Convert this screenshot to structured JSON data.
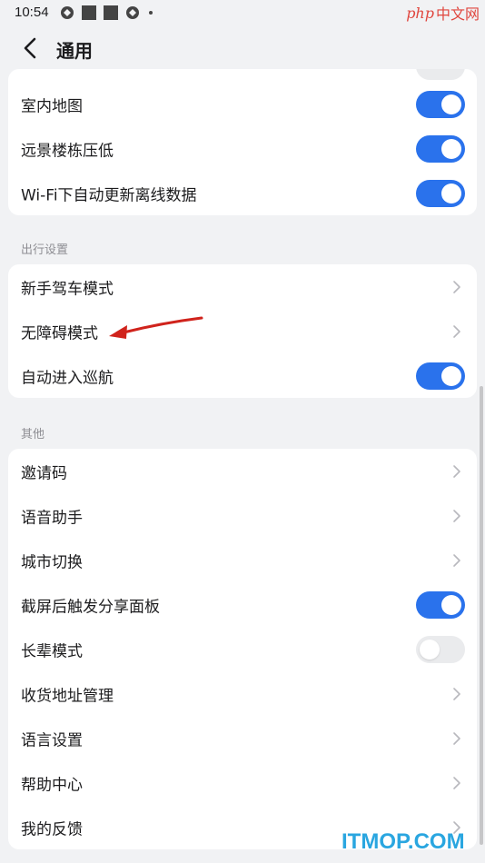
{
  "status_bar": {
    "time": "10:54",
    "logo_php": "php",
    "logo_cn": "中文网"
  },
  "header": {
    "title": "通用"
  },
  "card_top": {
    "items": [
      {
        "label": "室内地图",
        "type": "toggle",
        "on": true
      },
      {
        "label": "远景楼栋压低",
        "type": "toggle",
        "on": true
      },
      {
        "label": "Wi-Fi下自动更新离线数据",
        "type": "toggle",
        "on": true
      }
    ]
  },
  "section_travel": {
    "title": "出行设置",
    "items": [
      {
        "label": "新手驾车模式",
        "type": "link"
      },
      {
        "label": "无障碍模式",
        "type": "link"
      },
      {
        "label": "自动进入巡航",
        "type": "toggle",
        "on": true
      }
    ]
  },
  "section_other": {
    "title": "其他",
    "items": [
      {
        "label": "邀请码",
        "type": "link"
      },
      {
        "label": "语音助手",
        "type": "link"
      },
      {
        "label": "城市切换",
        "type": "link"
      },
      {
        "label": "截屏后触发分享面板",
        "type": "toggle",
        "on": true
      },
      {
        "label": "长辈模式",
        "type": "toggle",
        "on": false
      },
      {
        "label": "收货地址管理",
        "type": "link"
      },
      {
        "label": "语言设置",
        "type": "link"
      },
      {
        "label": "帮助中心",
        "type": "link"
      },
      {
        "label": "我的反馈",
        "type": "link"
      }
    ]
  },
  "watermark": {
    "text": "ITMOP.COM"
  },
  "colors": {
    "accent": "#2a72ec",
    "toggle_off": "#eaebed",
    "background": "#f1f2f4",
    "arrow": "#d0231c",
    "watermark": "#2aa6e0"
  }
}
